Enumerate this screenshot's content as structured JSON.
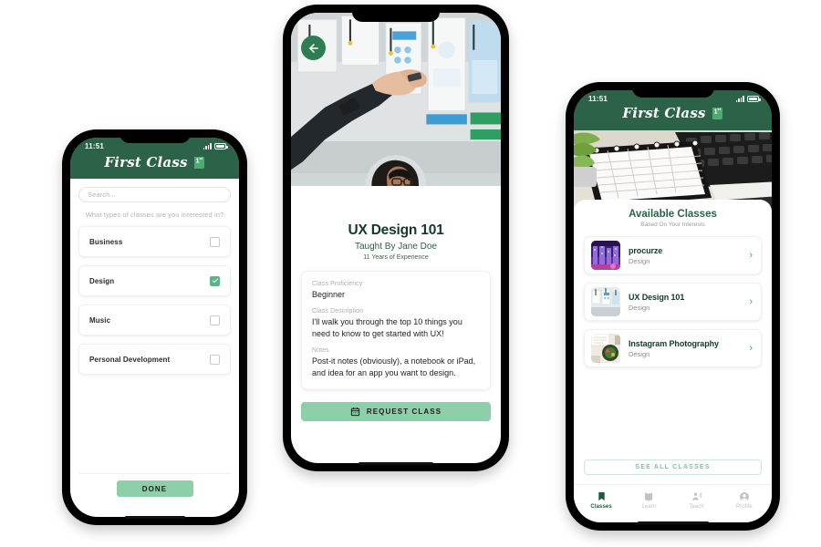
{
  "brand": {
    "name": "First Class",
    "logo_icon": "book-1st-icon",
    "header_color": "#2c6248",
    "accent_green": "#8ccfa8",
    "dark_green": "#2c6248"
  },
  "phone1": {
    "status": {
      "time": "11:51",
      "signal_icon": "cellular-bars-icon",
      "battery_icon": "battery-icon"
    },
    "search": {
      "placeholder": "Search...",
      "value": ""
    },
    "prompt": "What types of classes are you interested in?",
    "categories": [
      {
        "label": "Business",
        "checked": false
      },
      {
        "label": "Design",
        "checked": true
      },
      {
        "label": "Music",
        "checked": false
      },
      {
        "label": "Personal Development",
        "checked": false
      }
    ],
    "done_label": "DONE"
  },
  "phone2": {
    "back_icon": "arrow-left-icon",
    "hero_image": "person-placing-sticky-notes-on-wireframe-wall",
    "avatar_image": "instructor-portrait",
    "title": "UX Design 101",
    "instructor": "Taught By Jane Doe",
    "experience": "11 Years of Experience",
    "details": [
      {
        "label": "Class Proficiency",
        "value": "Beginner"
      },
      {
        "label": "Class Description",
        "value": "I'll walk you through the top 10 things you need to know to get started with UX!"
      },
      {
        "label": "Notes",
        "value": "Post-it notes (obviously), a notebook or iPad, and idea for an app you want to design."
      }
    ],
    "request_button": {
      "label": "REQUEST CLASS",
      "icon": "calendar-icon"
    }
  },
  "phone3": {
    "status": {
      "time": "11:51",
      "signal_icon": "cellular-bars-icon",
      "battery_icon": "battery-icon"
    },
    "hero_image": "planner-notebook-and-laptop-on-desk",
    "heading": "Available Classes",
    "subheading": "Based On Your Interests",
    "classes": [
      {
        "name": "procurze",
        "category": "Design",
        "thumb": "neon-city-thumbnail",
        "chevron": "chevron-right-icon"
      },
      {
        "name": "UX Design 101",
        "category": "Design",
        "thumb": "wireframe-wall-thumbnail",
        "chevron": "chevron-right-icon"
      },
      {
        "name": "Instagram Photography",
        "category": "Design",
        "thumb": "food-flatlay-thumbnail",
        "chevron": "chevron-right-icon"
      }
    ],
    "see_all_label": "SEE ALL CLASSES",
    "tabs": [
      {
        "label": "Classes",
        "icon": "bookmark-icon",
        "active": true
      },
      {
        "label": "Learn",
        "icon": "open-book-icon",
        "active": false
      },
      {
        "label": "Teach",
        "icon": "person-speaking-icon",
        "active": false
      },
      {
        "label": "Profile",
        "icon": "account-circle-icon",
        "active": false
      }
    ]
  }
}
